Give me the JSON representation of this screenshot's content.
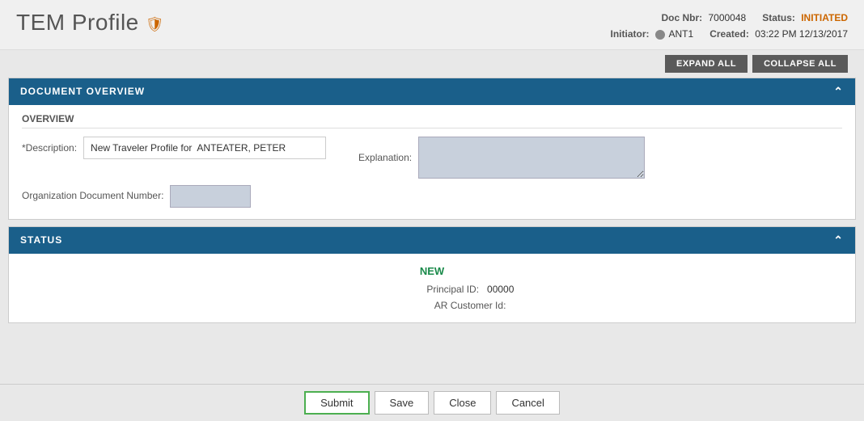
{
  "header": {
    "title": "TEM Profile",
    "icon": "🛡",
    "doc_nbr_label": "Doc Nbr:",
    "doc_nbr_value": "7000048",
    "status_label": "Status:",
    "status_value": "INITIATED",
    "initiator_label": "Initiator:",
    "initiator_value": "ANT1",
    "created_label": "Created:",
    "created_value": "03:22 PM 12/13/2017"
  },
  "toolbar": {
    "expand_all": "EXPAND ALL",
    "collapse_all": "COLLAPSE ALL"
  },
  "document_overview": {
    "section_title": "DOCUMENT OVERVIEW",
    "subsection_title": "OVERVIEW",
    "description_label": "*Description:",
    "description_value": "New Traveler Profile for  ANTEATER, PETER",
    "explanation_label": "Explanation:",
    "org_doc_label": "Organization Document Number:"
  },
  "status_section": {
    "section_title": "STATUS",
    "status_new": "NEW",
    "principal_id_label": "Principal ID:",
    "principal_id_value": "00000",
    "ar_customer_label": "AR Customer Id:"
  },
  "footer": {
    "submit_label": "Submit",
    "save_label": "Save",
    "close_label": "Close",
    "cancel_label": "Cancel"
  }
}
